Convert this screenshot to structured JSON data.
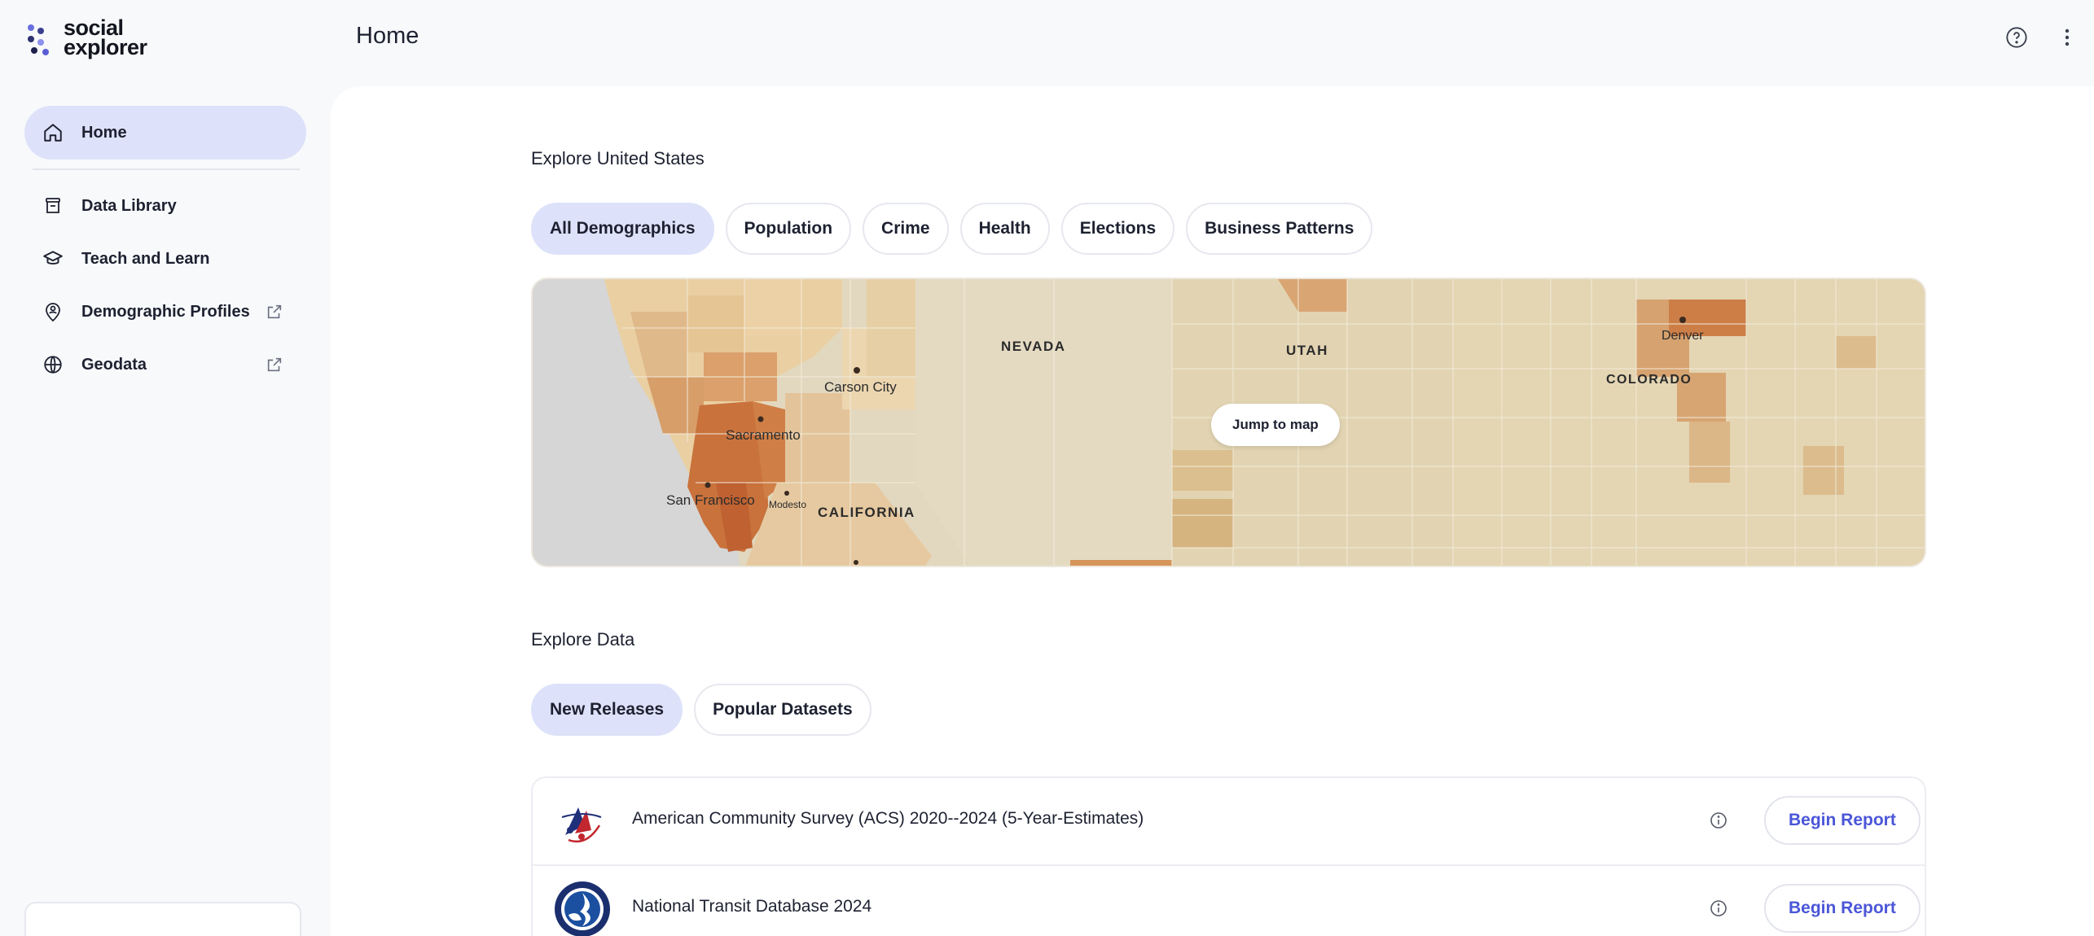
{
  "app": {
    "logo_line1": "social",
    "logo_line2": "explorer"
  },
  "header": {
    "title": "Home",
    "help_icon": "help-circle-icon",
    "menu_icon": "more-vertical-icon"
  },
  "sidebar": {
    "items": [
      {
        "label": "Home",
        "icon": "home-icon",
        "active": true
      },
      {
        "label": "Data Library",
        "icon": "archive-icon"
      },
      {
        "label": "Teach and Learn",
        "icon": "graduation-cap-icon"
      },
      {
        "label": "Demographic Profiles",
        "icon": "map-pin-user-icon",
        "external": true
      },
      {
        "label": "Geodata",
        "icon": "globe-icon",
        "external": true
      }
    ]
  },
  "explore_us": {
    "title": "Explore United States",
    "tabs": [
      "All Demographics",
      "Population",
      "Crime",
      "Health",
      "Elections",
      "Business Patterns"
    ],
    "active_tab": "All Demographics",
    "map_labels": {
      "nevada": "NEVADA",
      "utah": "UTAH",
      "colorado": "COLORADO",
      "california": "CALIFORNIA",
      "carson_city": "Carson City",
      "sacramento": "Sacramento",
      "san_francisco": "San Francisco",
      "modesto": "Modesto",
      "denver": "Denver"
    },
    "jump_label": "Jump to map"
  },
  "explore_data": {
    "title": "Explore Data",
    "tabs": [
      "New Releases",
      "Popular Datasets"
    ],
    "active_tab": "New Releases",
    "rows": [
      {
        "title": "American Community Survey (ACS) 2020--2024 (5-Year-Estimates)",
        "action": "Begin Report"
      },
      {
        "title": "National Transit Database 2024",
        "action": "Begin Report"
      }
    ]
  },
  "colors": {
    "accent": "#4a56d8",
    "active_bg": "#dde2fa",
    "map_light": "#e6d9bb",
    "map_dark": "#c9723c"
  }
}
